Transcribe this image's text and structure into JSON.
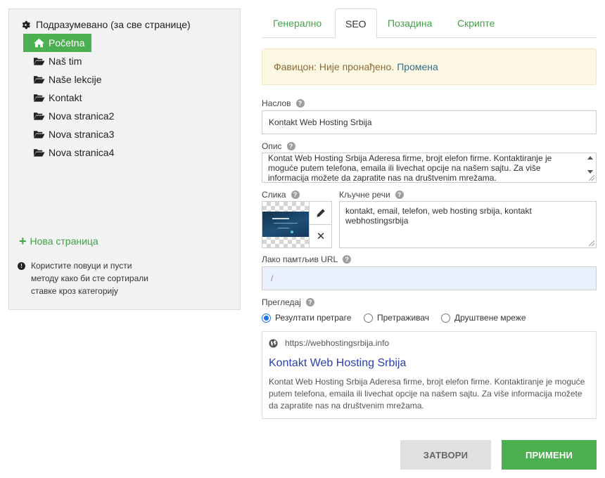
{
  "sidebar": {
    "root_label": "Подразумевано (за све странице)",
    "items": [
      {
        "label": "Početna",
        "icon": "home-icon",
        "active": true
      },
      {
        "label": "Naš tim",
        "icon": "folder-open-icon"
      },
      {
        "label": "Naše lekcije",
        "icon": "folder-open-icon"
      },
      {
        "label": "Kontakt",
        "icon": "folder-open-icon"
      },
      {
        "label": "Nova stranica2",
        "icon": "folder-open-icon"
      },
      {
        "label": "Nova stranica3",
        "icon": "folder-open-icon"
      },
      {
        "label": "Nova stranica4",
        "icon": "folder-open-icon"
      }
    ],
    "new_page_label": "Нова страница",
    "hint": "Користите повуци и пусти методу како би сте сортирали ставке кроз категорију"
  },
  "tabs": [
    {
      "label": "Генерално"
    },
    {
      "label": "SEO",
      "active": true
    },
    {
      "label": "Позадина"
    },
    {
      "label": "Скрипте"
    }
  ],
  "alert": {
    "text": "Фавицон: Није пронађено.",
    "link": "Промена"
  },
  "form": {
    "title_label": "Наслов",
    "title_value": "Kontakt Web Hosting Srbija",
    "description_label": "Опис",
    "description_value": "Kontat Web Hosting Srbija Aderesa firme, brojt elefon firme. Kontaktiranje je moguće putem telefona, emaila ili livechat opcije na našem sajtu. Za više informacija možete da zapratite nas na društvenim mrežama.",
    "image_label": "Слика",
    "keywords_label": "Кључне речи",
    "keywords_value": "kontakt, email, telefon, web hosting srbija, kontakt webhostingsrbija",
    "url_label": "Лако памтљив URL",
    "url_value": "/",
    "preview_label": "Прегледај",
    "preview_options": [
      {
        "label": "Резултати претраге",
        "checked": true
      },
      {
        "label": "Претраживач",
        "checked": false
      },
      {
        "label": "Друштвене мреже",
        "checked": false
      }
    ]
  },
  "preview": {
    "url": "https://webhostingsrbija.info",
    "title": "Kontakt Web Hosting Srbija",
    "description": "Kontat Web Hosting Srbija Aderesa firme, brojt elefon firme. Kontaktiranje je moguće putem telefona, emaila ili livechat opcije na našem sajtu. Za više informacija možete da zapratite nas na društvenim mrežama."
  },
  "buttons": {
    "close": "ЗАТВОРИ",
    "apply": "ПРИМЕНИ"
  },
  "colors": {
    "accent_green": "#4caf50",
    "link_blue": "#2a3fb0",
    "alert_bg": "#fcf8e3",
    "alert_text": "#8a6d3b"
  }
}
